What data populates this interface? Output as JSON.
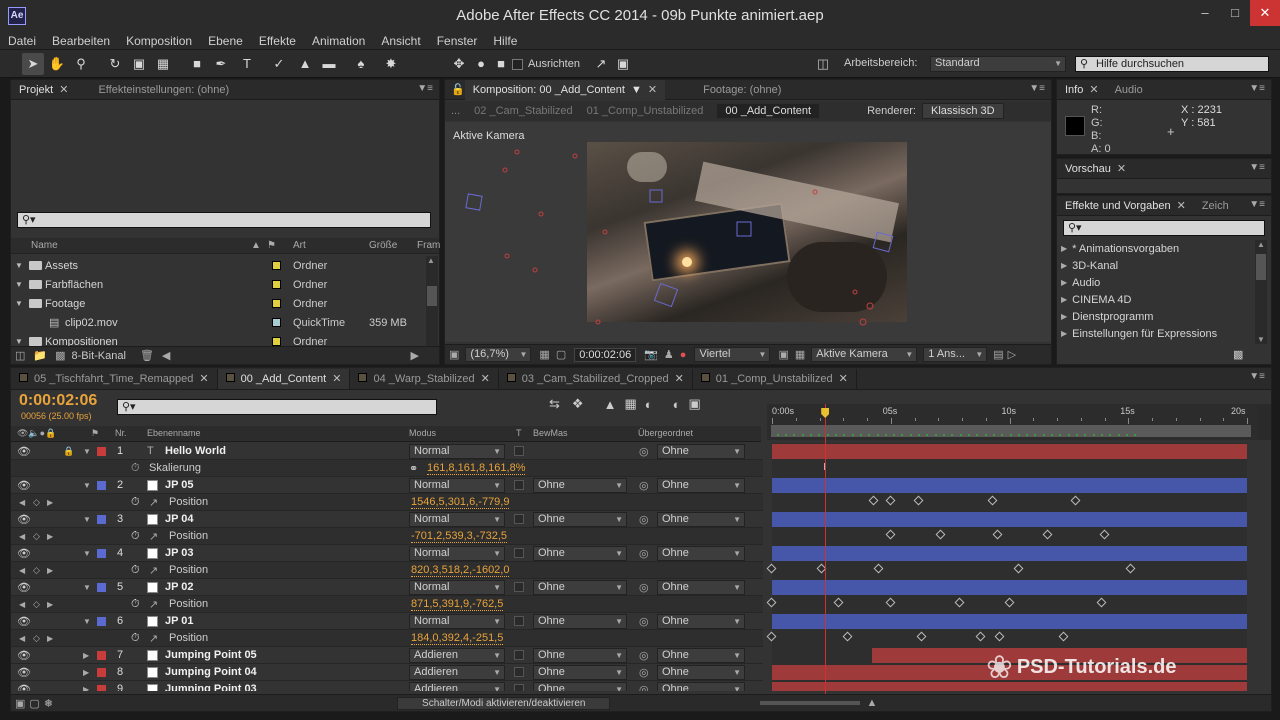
{
  "app": {
    "logo": "Ae",
    "title": "Adobe After Effects CC 2014 - 09b Punkte animiert.aep"
  },
  "menu": [
    "Datei",
    "Bearbeiten",
    "Komposition",
    "Ebene",
    "Effekte",
    "Animation",
    "Ansicht",
    "Fenster",
    "Hilfe"
  ],
  "toolbar": {
    "ausrichten": "Ausrichten",
    "arbeitsbereich_label": "Arbeitsbereich:",
    "arbeitsbereich_value": "Standard",
    "help_placeholder": "Hilfe durchsuchen"
  },
  "project": {
    "tab": "Projekt",
    "tab2": "Effekteinstellungen: (ohne)",
    "col_name": "Name",
    "col_art": "Art",
    "col_size": "Größe",
    "col_fram": "Fram",
    "items": [
      {
        "name": "Assets",
        "type": "Ordner",
        "size": "",
        "label": "#e0d040"
      },
      {
        "name": "Farbflächen",
        "type": "Ordner",
        "size": "",
        "label": "#e0d040"
      },
      {
        "name": "Footage",
        "type": "Ordner",
        "size": "",
        "label": "#e0d040"
      },
      {
        "name": "clip02.mov",
        "type": "QuickTime",
        "size": "359 MB",
        "label": "#a7cdd0"
      },
      {
        "name": "Kompositionen",
        "type": "Ordner",
        "size": "",
        "label": "#e0d040"
      }
    ],
    "bitdepth": "8-Bit-Kanal"
  },
  "comp": {
    "tab": "Komposition: 00 _Add_Content",
    "footage_tab": "Footage: (ohne)",
    "crumbs": [
      "02 _Cam_Stabilized",
      "01 _Comp_Unstabilized",
      "00 _Add_Content"
    ],
    "renderer_label": "Renderer:",
    "renderer": "Klassisch 3D",
    "viewer_label": "Aktive Kamera",
    "zoom": "(16,7%)",
    "time": "0:00:02:06",
    "quality": "Viertel",
    "view": "Aktive Kamera",
    "views": "1 Ans..."
  },
  "info": {
    "tab": "Info",
    "tab2": "Audio",
    "r": "R:",
    "g": "G:",
    "b": "B:",
    "a": "A:",
    "a_val": "0",
    "x": "X : 2231",
    "y": "Y : 581"
  },
  "preview": {
    "tab": "Vorschau"
  },
  "effects": {
    "tab": "Effekte und Vorgaben",
    "tab2": "Zeich",
    "items": [
      "* Animationsvorgaben",
      "3D-Kanal",
      "Audio",
      "CINEMA 4D",
      "Dienstprogramm",
      "Einstellungen für Expressions"
    ]
  },
  "timeline": {
    "tabs": [
      "05 _Tischfahrt_Time_Remapped",
      "00 _Add_Content",
      "04 _Warp_Stabilized",
      "03 _Cam_Stabilized_Cropped",
      "01 _Comp_Unstabilized"
    ],
    "timecode": "0:00:02:06",
    "frames": "00056 (25.00 fps)",
    "cols": {
      "nr": "Nr.",
      "name": "Ebenenname",
      "mode": "Modus",
      "t": "T",
      "bewmas": "BewMas",
      "parent": "Übergeordnet"
    },
    "ruler": [
      "0:00s",
      "05s",
      "10s",
      "15s",
      "20s"
    ],
    "current_time_s": 2.24,
    "duration_s": 20,
    "rows": [
      {
        "kind": "layer",
        "nr": "1",
        "name": "Hello World",
        "mode": "Normal",
        "bew": "",
        "parent": "Ohne",
        "label": "#c83c3c",
        "icon": "T",
        "bar": [
          0,
          20
        ],
        "barcolor": "#9e3a3a"
      },
      {
        "kind": "prop",
        "name": "Skalierung",
        "value": "161,8,161,8,161,8%",
        "keys": []
      },
      {
        "kind": "layer",
        "nr": "2",
        "name": "JP 05",
        "mode": "Normal",
        "bew": "Ohne",
        "parent": "Ohne",
        "label": "#5a6ad0",
        "icon": "box",
        "bar": [
          0,
          20
        ],
        "barcolor": "#4656a8"
      },
      {
        "kind": "prop",
        "name": "Position",
        "value": "1546,5,301,6,-779,9",
        "keys": [
          4.3,
          5.0,
          6.2,
          9.3,
          12.8
        ]
      },
      {
        "kind": "layer",
        "nr": "3",
        "name": "JP 04",
        "mode": "Normal",
        "bew": "Ohne",
        "parent": "Ohne",
        "label": "#5a6ad0",
        "icon": "box",
        "bar": [
          0,
          20
        ],
        "barcolor": "#4656a8"
      },
      {
        "kind": "prop",
        "name": "Position",
        "value": "-701,2,539,3,-732,5",
        "keys": [
          5.0,
          7.1,
          9.5,
          11.6,
          14.0
        ]
      },
      {
        "kind": "layer",
        "nr": "4",
        "name": "JP 03",
        "mode": "Normal",
        "bew": "Ohne",
        "parent": "Ohne",
        "label": "#5a6ad0",
        "icon": "box",
        "bar": [
          0,
          20
        ],
        "barcolor": "#4656a8"
      },
      {
        "kind": "prop",
        "name": "Position",
        "value": "820,3,518,2,-1602,0",
        "keys": [
          0,
          2.1,
          4.5,
          10.4,
          15.1
        ]
      },
      {
        "kind": "layer",
        "nr": "5",
        "name": "JP 02",
        "mode": "Normal",
        "bew": "Ohne",
        "parent": "Ohne",
        "label": "#5a6ad0",
        "icon": "box",
        "bar": [
          0,
          20
        ],
        "barcolor": "#4656a8"
      },
      {
        "kind": "prop",
        "name": "Position",
        "value": "871,5,391,9,-762,5",
        "keys": [
          0,
          2.8,
          5.0,
          7.9,
          10.0,
          13.9
        ]
      },
      {
        "kind": "layer",
        "nr": "6",
        "name": "JP 01",
        "mode": "Normal",
        "bew": "Ohne",
        "parent": "Ohne",
        "label": "#5a6ad0",
        "icon": "box",
        "bar": [
          0,
          20
        ],
        "barcolor": "#4656a8"
      },
      {
        "kind": "prop",
        "name": "Position",
        "value": "184,0,392,4,-251,5",
        "keys": [
          0,
          3.2,
          6.3,
          8.8,
          9.6,
          12.3
        ]
      },
      {
        "kind": "layer",
        "nr": "7",
        "name": "Jumping Point 05",
        "mode": "Addieren",
        "bew": "Ohne",
        "parent": "Ohne",
        "label": "#c83c3c",
        "icon": "box",
        "bar": [
          4.2,
          20
        ],
        "barcolor": "#9e3a3a"
      },
      {
        "kind": "layer",
        "nr": "8",
        "name": "Jumping Point 04",
        "mode": "Addieren",
        "bew": "Ohne",
        "parent": "Ohne",
        "label": "#c83c3c",
        "icon": "box",
        "bar": [
          0,
          20
        ],
        "barcolor": "#9e3a3a"
      },
      {
        "kind": "layer",
        "nr": "9",
        "name": "Jumping Point 03",
        "mode": "Addieren",
        "bew": "Ohne",
        "parent": "Ohne",
        "label": "#c83c3c",
        "icon": "box",
        "bar": [
          0,
          20
        ],
        "barcolor": "#9e3a3a"
      }
    ],
    "switch_label": "Schalter/Modi aktivieren/deaktivieren"
  },
  "watermark": "PSD-Tutorials.de"
}
